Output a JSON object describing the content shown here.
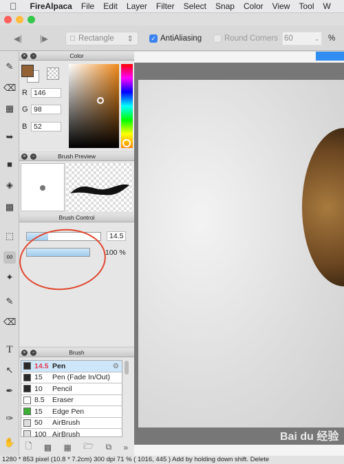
{
  "menubar": {
    "apple": "",
    "items": [
      "FireAlpaca",
      "File",
      "Edit",
      "Layer",
      "Filter",
      "Select",
      "Snap",
      "Color",
      "View",
      "Tool",
      "W"
    ]
  },
  "toolbar": {
    "shape": "Rectangle",
    "antialiasing_label": "AntiAliasing",
    "antialiasing_checked": true,
    "round_corners_label": "Round Corners",
    "round_corners_checked": false,
    "corner_value": "60",
    "unit": "%"
  },
  "color_panel": {
    "title": "Color",
    "r_label": "R",
    "r": "146",
    "g_label": "G",
    "g": "98",
    "b_label": "B",
    "b": "52",
    "current_color": "#926234"
  },
  "brush_preview": {
    "title": "Brush Preview"
  },
  "brush_control": {
    "title": "Brush Control",
    "size": "14.5",
    "size_fraction": 0.29,
    "opacity": "100 %",
    "opacity_fraction": 1.0
  },
  "brush_panel": {
    "title": "Brush",
    "items": [
      {
        "size": "14.5",
        "name": "Pen",
        "color": "#2a2a2a",
        "selected": true
      },
      {
        "size": "15",
        "name": "Pen (Fade In/Out)",
        "color": "#2a2a2a"
      },
      {
        "size": "10",
        "name": "Pencil",
        "color": "#2a2a2a"
      },
      {
        "size": "8.5",
        "name": "Eraser",
        "color": "#ffffff"
      },
      {
        "size": "15",
        "name": "Edge Pen",
        "color": "#3cb034"
      },
      {
        "size": "50",
        "name": "AirBrush",
        "color": "#dddddd"
      },
      {
        "size": "100",
        "name": "AirBrush",
        "color": "#dddddd"
      }
    ]
  },
  "status": {
    "text": "1280 * 853 pixel   (10.8 * 7.2cm)   300 dpi   71 %   ( 1016, 445 )   Add by holding down shift. Delete"
  },
  "watermark": "Bai du 经验"
}
